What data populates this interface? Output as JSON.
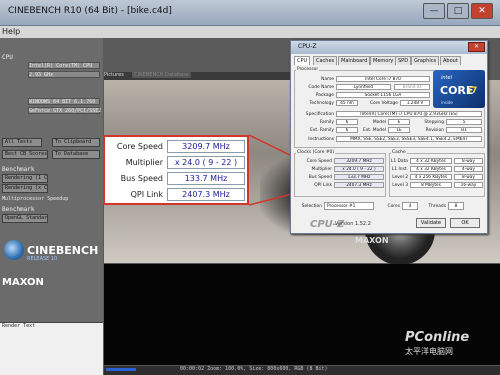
{
  "cinebench": {
    "title": "CINEBENCH R10 (64 Bit) - [bike.c4d]",
    "menu_help": "Help",
    "sections": {
      "cpu_label": "CPU",
      "type": "Intel(R) Core(TM) CPU",
      "clock": "2.93 GHz",
      "os": "WINDOWS 64 BIT 6.1.760",
      "gpu": "GeForce GTX 260/PCI/SSE2",
      "btn_all_tests": "All Tests",
      "btn_clipboard": "To Clipboard",
      "btn_cb_scores": "Best CB Scores",
      "btn_database": "To Database",
      "benchmark_label": "Benchmark",
      "rendering_1cpu": "Rendering (1 CPU)",
      "rendering_xcpu": "Rendering (x CPU)",
      "multiprocessor_speedup": "Multiprocessor Speedup",
      "shading_label": "Benchmark",
      "opengl_standard": "OpenGL Standard",
      "render_text": "Render Text"
    },
    "logo_name": "CINEBENCH",
    "logo_release": "RELEASE 10",
    "maxon": "MAXON",
    "tab_pictures": "Pictures",
    "tab_database": "CINEBENCH Database",
    "scene_watermark": "MAXON",
    "status": "00:00:02  Zoom: 100.0%, Size: 800x600, RGB (8 Bit)"
  },
  "callout": {
    "core_speed_label": "Core Speed",
    "core_speed_value": "3209.7 MHz",
    "multiplier_label": "Multiplier",
    "multiplier_value": "x 24.0 ( 9 - 22 )",
    "bus_speed_label": "Bus Speed",
    "bus_speed_value": "133.7 MHz",
    "qpi_label": "QPI Link",
    "qpi_value": "2407.3 MHz"
  },
  "cpuz": {
    "title": "CPU-Z",
    "tabs": [
      "CPU",
      "Caches",
      "Mainboard",
      "Memory",
      "SPD",
      "Graphics",
      "About"
    ],
    "processor": {
      "group": "Processor",
      "name_label": "Name",
      "name": "Intel Core i7 870",
      "codename_label": "Code Name",
      "codename": "Lynnfield",
      "brand_id": "Brand ID",
      "package_label": "Package",
      "package": "Socket 1156 LGA",
      "technology_label": "Technology",
      "technology": "45 nm",
      "core_voltage_label": "Core Voltage",
      "core_voltage": "1.248 V",
      "spec_label": "Specification",
      "spec": "Intel(R) Core(TM) i7 CPU   870  @ 2.93GHz (ES)",
      "family_label": "Family",
      "family": "6",
      "model_label": "Model",
      "model": "E",
      "stepping_label": "Stepping",
      "stepping": "5",
      "ext_family_label": "Ext. Family",
      "ext_family": "6",
      "ext_model_label": "Ext. Model",
      "ext_model": "1E",
      "revision_label": "Revision",
      "revision": "B1",
      "instructions_label": "Instructions",
      "instructions": "MMX, SSE, SSE2, SSE3, SSSE3, SSE4.1, SSE4.2, EM64T"
    },
    "clocks": {
      "group": "Clocks (Core #0)",
      "core_speed_label": "Core Speed",
      "core_speed": "3209.7 MHz",
      "multiplier_label": "Multiplier",
      "multiplier": "x 24.0 ( 9 - 22 )",
      "bus_speed_label": "Bus Speed",
      "bus_speed": "133.7 MHz",
      "qpi_label": "QPI Link",
      "qpi": "2407.3 MHz"
    },
    "cache": {
      "group": "Cache",
      "l1d_label": "L1 Data",
      "l1d": "4 x 32 KBytes",
      "l1d_way": "8-way",
      "l1i_label": "L1 Inst.",
      "l1i": "4 x 32 KBytes",
      "l1i_way": "4-way",
      "l2_label": "Level 2",
      "l2": "4 x 256 KBytes",
      "l2_way": "8-way",
      "l3_label": "Level 3",
      "l3": "8 MBytes",
      "l3_way": "16-way"
    },
    "selection_label": "Selection",
    "selection_value": "Processor #1",
    "cores_label": "Cores",
    "cores": "4",
    "threads_label": "Threads",
    "threads": "8",
    "logo": "CPU-Z",
    "version": "Version 1.52.2",
    "validate": "Validate",
    "ok": "OK",
    "intel_word": "intel",
    "core_word": "CORE",
    "i7_word": "i7",
    "inside_word": "inside"
  },
  "watermark": {
    "brand": "PConline",
    "chinese": "太平洋电脑网"
  },
  "colors": {
    "callout_border": "#d2352a",
    "value_text": "#1a1a9e",
    "intel_blue": "#2a66c2"
  },
  "icons": {
    "close": "close-icon",
    "minimize": "minimize-icon",
    "maximize": "maximize-icon"
  }
}
